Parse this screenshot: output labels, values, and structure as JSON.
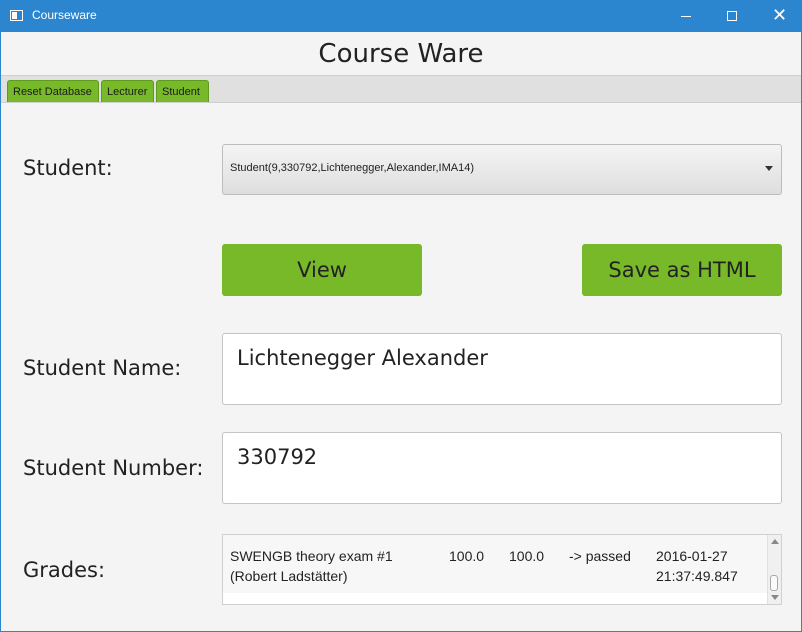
{
  "window": {
    "title": "Courseware"
  },
  "heading": "Course Ware",
  "tabs": [
    {
      "label": "Reset Database"
    },
    {
      "label": "Lecturer"
    },
    {
      "label": "Student"
    }
  ],
  "form": {
    "student_label": "Student:",
    "student_selected": "Student(9,330792,Lichtenegger,Alexander,IMA14)",
    "view_button": "View",
    "save_button": "Save as HTML",
    "name_label": "Student Name:",
    "name_value": "Lichtenegger Alexander",
    "number_label": "Student Number:",
    "number_value": "330792",
    "grades_label": "Grades:"
  },
  "grades": [
    {
      "title": "SWENGB theory exam #1\n(Robert Ladstätter)",
      "score1": "100.0",
      "score2": "100.0",
      "status": "-> passed",
      "datetime": "2016-01-27\n21:37:49.847"
    }
  ],
  "colors": {
    "accent": "#78b92a",
    "titlebar": "#2b85cf"
  }
}
